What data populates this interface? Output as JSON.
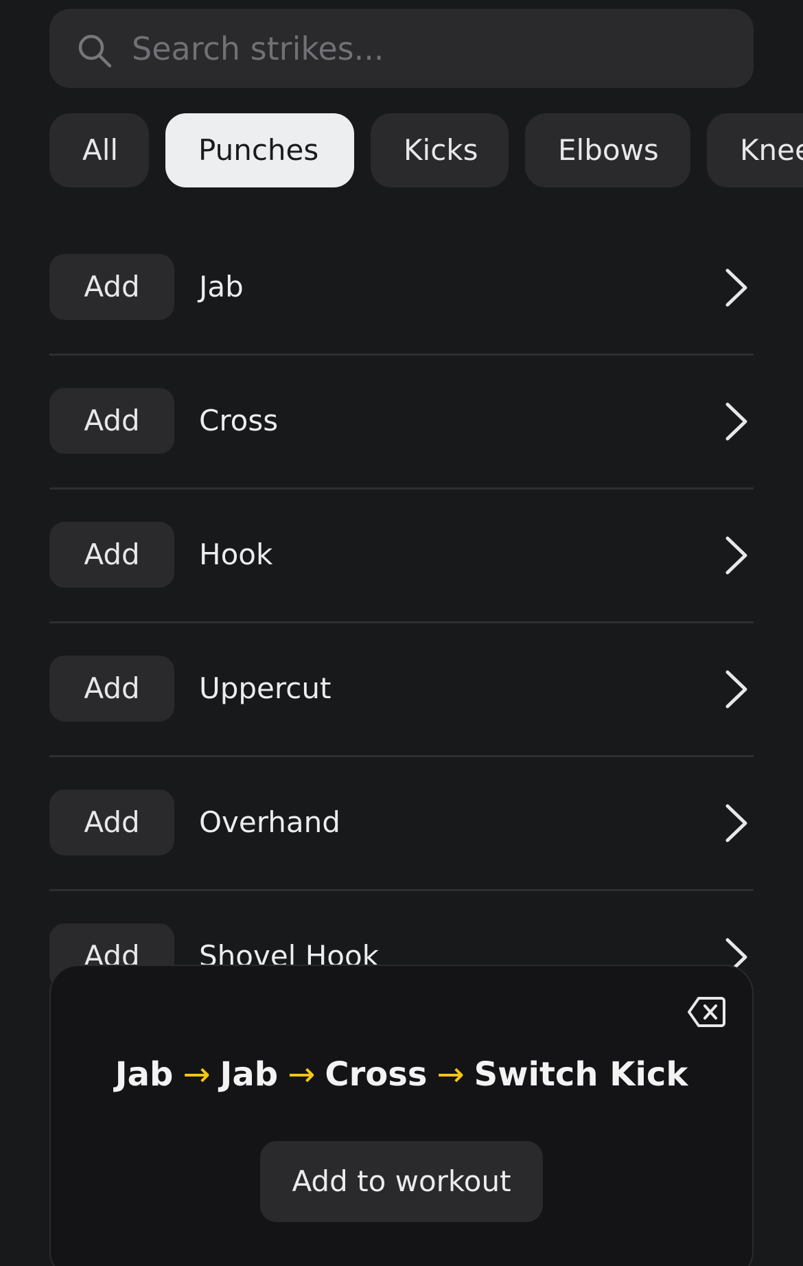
{
  "search": {
    "placeholder": "Search strikes...",
    "icon": "search-icon"
  },
  "filters": [
    {
      "label": "All",
      "selected": false
    },
    {
      "label": "Punches",
      "selected": true
    },
    {
      "label": "Kicks",
      "selected": false
    },
    {
      "label": "Elbows",
      "selected": false
    },
    {
      "label": "Knees",
      "selected": false
    }
  ],
  "strikes": [
    {
      "add_label": "Add",
      "name": "Jab"
    },
    {
      "add_label": "Add",
      "name": "Cross"
    },
    {
      "add_label": "Add",
      "name": "Hook"
    },
    {
      "add_label": "Add",
      "name": "Uppercut"
    },
    {
      "add_label": "Add",
      "name": "Overhand"
    },
    {
      "add_label": "Add",
      "name": "Shovel Hook"
    }
  ],
  "combo": {
    "sequence": [
      "Jab",
      "Jab",
      "Cross",
      "Switch Kick"
    ],
    "separator": "→",
    "add_button_label": "Add to workout",
    "clear_icon": "backspace-icon"
  },
  "colors": {
    "background": "#18191b",
    "surface": "#2a2a2d",
    "selected_chip": "#eceef0",
    "arrow_accent": "#f5c518"
  }
}
